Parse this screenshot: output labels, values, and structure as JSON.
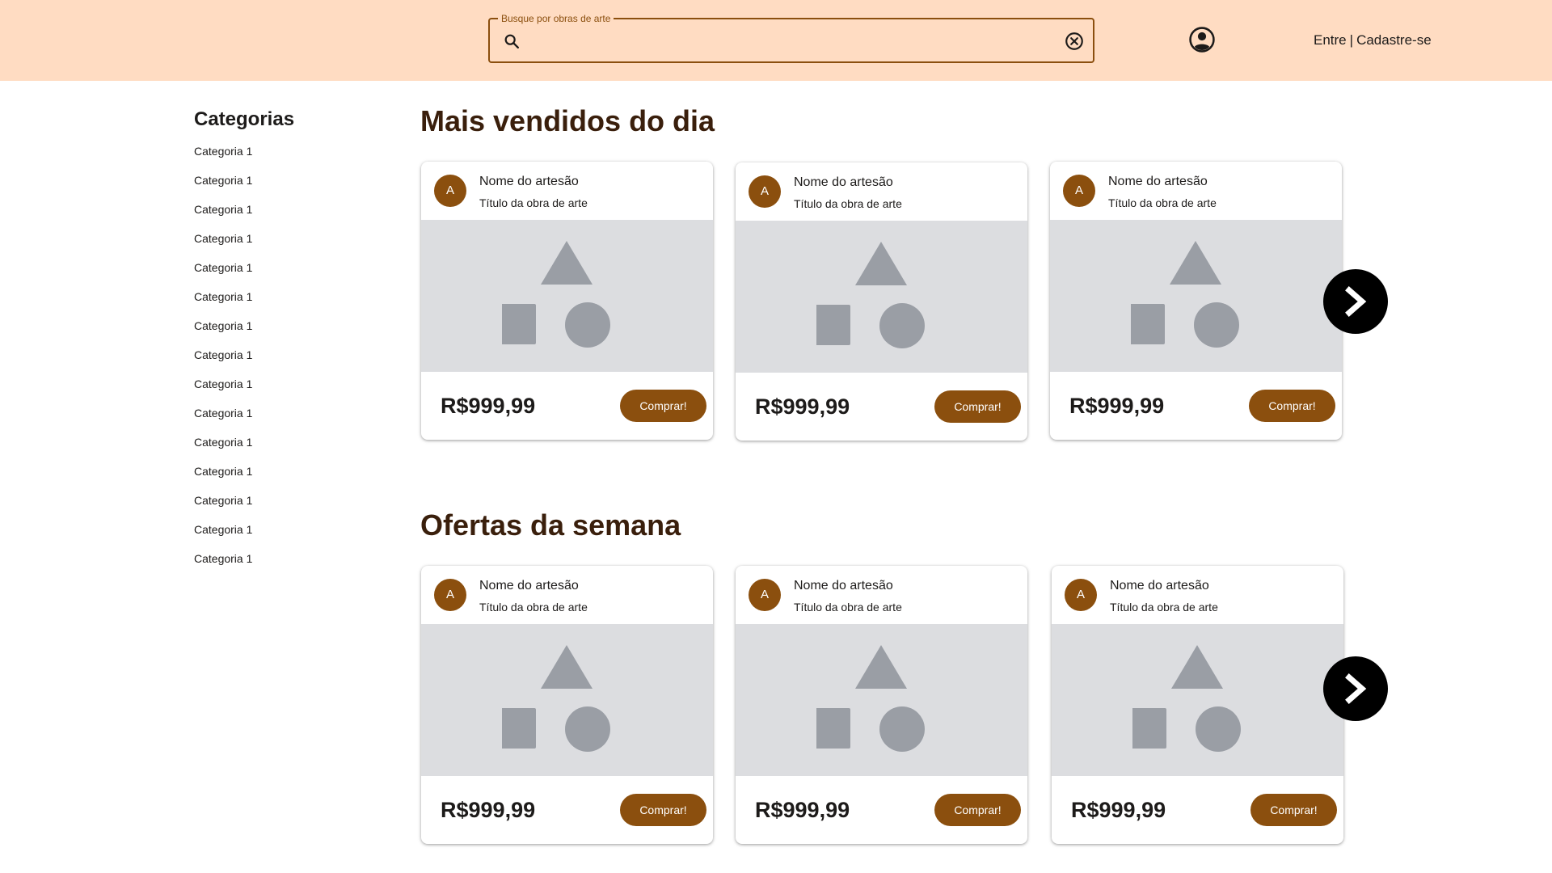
{
  "header": {
    "search_label": "Busque por obras de arte",
    "search_value": "",
    "search_icon": "search-icon",
    "clear_icon": "cancel-circle-icon",
    "account_icon": "account-circle-icon",
    "login_label": "Entre",
    "separator": "|",
    "signup_label": "Cadastre-se"
  },
  "sidebar": {
    "title": "Categorias",
    "items": [
      "Categoria 1",
      "Categoria 1",
      "Categoria 1",
      "Categoria 1",
      "Categoria 1",
      "Categoria 1",
      "Categoria 1",
      "Categoria 1",
      "Categoria 1",
      "Categoria 1",
      "Categoria 1",
      "Categoria 1",
      "Categoria 1",
      "Categoria 1",
      "Categoria 1"
    ]
  },
  "sections": [
    {
      "title": "Mais vendidos do dia",
      "cards": [
        {
          "avatar": "A",
          "artisan": "Nome do artesão",
          "work_title": "Título da obra de arte",
          "price": "R$999,99",
          "buy_label": "Comprar!"
        },
        {
          "avatar": "A",
          "artisan": "Nome do artesão",
          "work_title": "Título da obra de arte",
          "price": "R$999,99",
          "buy_label": "Comprar!"
        },
        {
          "avatar": "A",
          "artisan": "Nome do artesão",
          "work_title": "Título da obra de arte",
          "price": "R$999,99",
          "buy_label": "Comprar!"
        }
      ],
      "next_icon": "chevron-right-icon"
    },
    {
      "title": "Ofertas da semana",
      "cards": [
        {
          "avatar": "A",
          "artisan": "Nome do artesão",
          "work_title": "Título da obra de arte",
          "price": "R$999,99",
          "buy_label": "Comprar!"
        },
        {
          "avatar": "A",
          "artisan": "Nome do artesão",
          "work_title": "Título da obra de arte",
          "price": "R$999,99",
          "buy_label": "Comprar!"
        },
        {
          "avatar": "A",
          "artisan": "Nome do artesão",
          "work_title": "Título da obra de arte",
          "price": "R$999,99",
          "buy_label": "Comprar!"
        }
      ],
      "next_icon": "chevron-right-icon"
    }
  ],
  "colors": {
    "header_bg": "#ffdcc2",
    "accent": "#8b4f0e",
    "placeholder_bg": "#dcdde0",
    "placeholder_shape": "#9a9ea5",
    "nav_button": "#000000"
  }
}
